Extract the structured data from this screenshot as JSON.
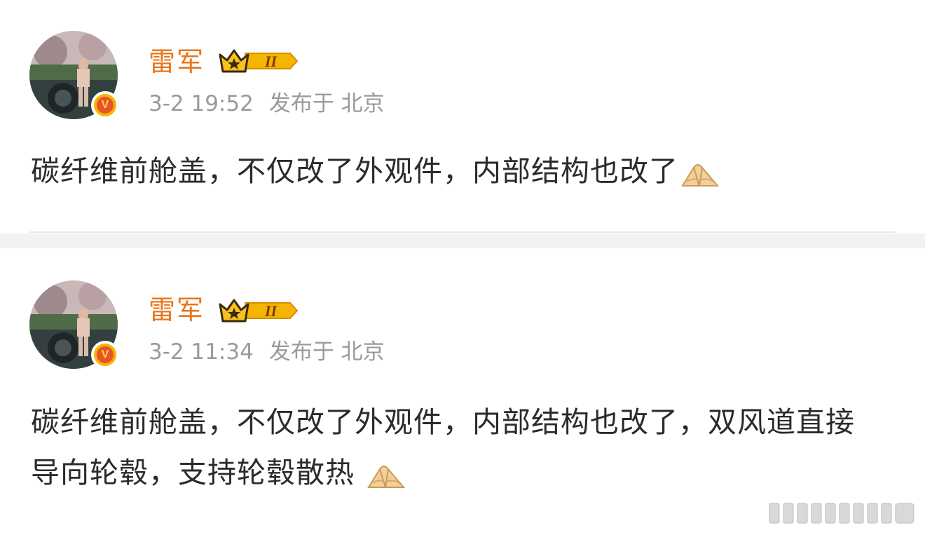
{
  "posts": [
    {
      "author": "雷军",
      "time": "3-2 19:52",
      "location": "发布于 北京",
      "text": "碳纤维前舱盖，不仅改了外观件，内部结构也改了",
      "emoji": "hands-emoji"
    },
    {
      "author": "雷军",
      "time": "3-2 11:34",
      "location": "发布于 北京",
      "text": "碳纤维前舱盖，不仅改了外观件，内部结构也改了，双风道直接导向轮毂，支持轮毂散热 ",
      "emoji": "hands-emoji"
    }
  ],
  "badges": {
    "vip_level": "II",
    "verified": "V"
  },
  "colors": {
    "name": "#e8761a",
    "meta": "#9a9a9a",
    "text": "#2b2b2b",
    "gold": "#f7b500"
  }
}
